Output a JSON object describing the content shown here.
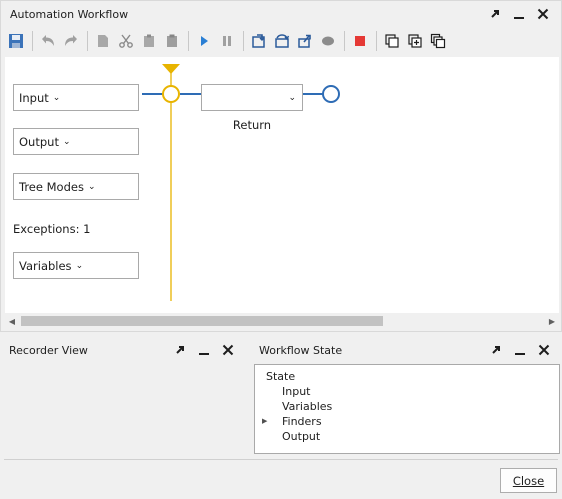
{
  "colors": {
    "flow_line": "#2e6cb5",
    "timeline": "#e8b400",
    "stop_red": "#e53935",
    "play_blue": "#2a7fd4"
  },
  "main_window": {
    "title": "Automation Workflow",
    "buttons": [
      "pin-icon",
      "minimize-icon",
      "close-icon"
    ]
  },
  "toolbar": {
    "items": [
      "save-icon",
      "undo-icon",
      "redo-icon",
      "copy-icon",
      "cut-icon",
      "paste-icon",
      "clipboard-icon",
      "run-icon",
      "pause-icon",
      "step-into-icon",
      "step-over-icon",
      "step-out-icon",
      "breakpoint-icon",
      "stop-icon",
      "window-icon",
      "window-add-icon",
      "window-cascade-icon"
    ]
  },
  "canvas": {
    "input_label": "Input",
    "output_label": "Output",
    "tree_modes_label": "Tree Modes",
    "exceptions_text": "Exceptions: 1",
    "variables_label": "Variables",
    "return_label": "Return",
    "return_dropdown_value": ""
  },
  "recorder_panel": {
    "title": "Recorder View"
  },
  "workflow_state_panel": {
    "title": "Workflow State",
    "tree": {
      "root": "State",
      "children": [
        "Input",
        "Variables",
        "Finders",
        "Output"
      ]
    }
  },
  "footer": {
    "close_label": "Close"
  }
}
